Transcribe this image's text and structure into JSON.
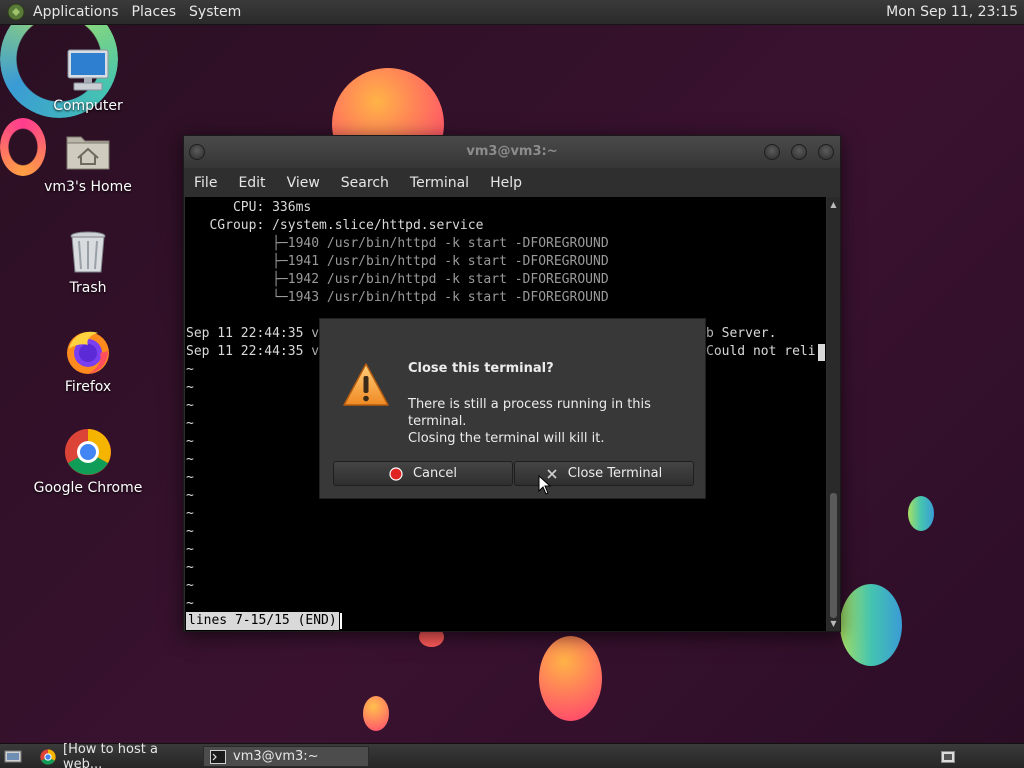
{
  "top_panel": {
    "menus": [
      "Applications",
      "Places",
      "System"
    ],
    "clock": "Mon Sep 11, 23:15",
    "logo_icon": "mate-logo-icon"
  },
  "desktop_icons": [
    {
      "label": "Computer",
      "icon": "computer-icon"
    },
    {
      "label": "vm3's Home",
      "icon": "home-folder-icon"
    },
    {
      "label": "Trash",
      "icon": "trash-icon"
    },
    {
      "label": "Firefox",
      "icon": "firefox-icon"
    },
    {
      "label": "Google Chrome",
      "icon": "chrome-icon"
    }
  ],
  "terminal": {
    "title": "vm3@vm3:~",
    "menus": [
      "File",
      "Edit",
      "View",
      "Search",
      "Terminal",
      "Help"
    ],
    "lines": [
      "      CPU: 336ms",
      "   CGroup: /system.slice/httpd.service",
      "           ├─1940 /usr/bin/httpd -k start -DFOREGROUND",
      "           ├─1941 /usr/bin/httpd -k start -DFOREGROUND",
      "           ├─1942 /usr/bin/httpd -k start -DFOREGROUND",
      "           └─1943 /usr/bin/httpd -k start -DFOREGROUND",
      "",
      "Sep 11 22:44:35 v",
      "Sep 11 22:44:35 v"
    ],
    "line_tail_1": "b Server.",
    "line_tail_2": "Could not reli",
    "tilde": "~",
    "status_line": "lines 7-15/15 (END)"
  },
  "dialog": {
    "title": "Close this terminal?",
    "message_1": "There is still a process running in this terminal.",
    "message_2": "Closing the terminal will kill it.",
    "cancel_label": "Cancel",
    "close_label": "Close Terminal",
    "warning_icon": "warning-icon"
  },
  "taskbar": {
    "show_desktop_icon": "show-desktop-icon",
    "tasks": [
      {
        "label": "[How to host a web...",
        "icon": "chrome-icon"
      },
      {
        "label": "vm3@vm3:~",
        "icon": "terminal-icon"
      }
    ],
    "workspace_icon": "workspace-switcher-icon"
  },
  "colors": {
    "desktop_bg": "#2a0f22",
    "panel": "#2f2f2f",
    "terminal_bg": "#000000",
    "dialog_bg": "#383838",
    "cancel_dot": "#e02424"
  }
}
